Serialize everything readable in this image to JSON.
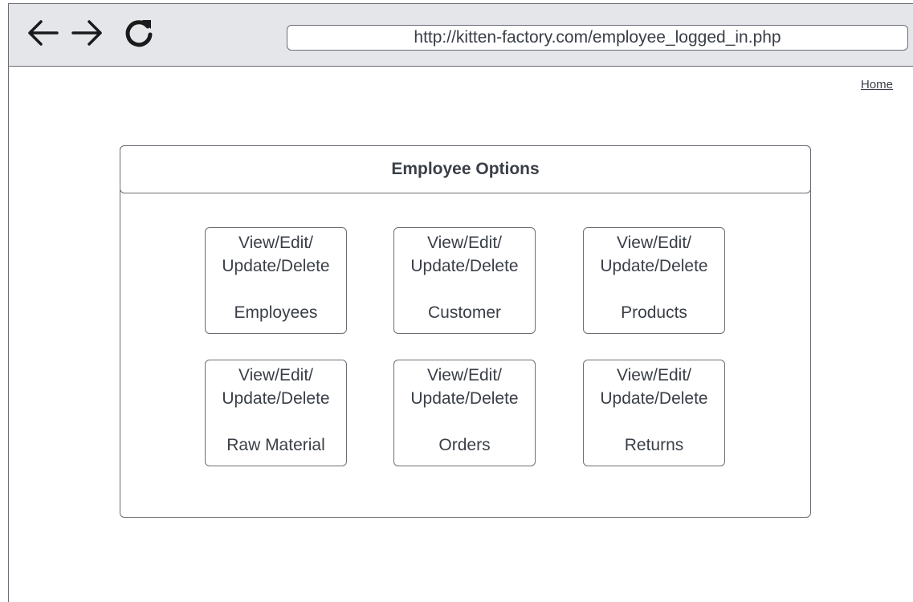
{
  "browser": {
    "url": "http://kitten-factory.com/employee_logged_in.php",
    "back_icon": "arrow-left-icon",
    "forward_icon": "arrow-right-icon",
    "reload_icon": "reload-icon"
  },
  "header": {
    "home_link": "Home"
  },
  "panel": {
    "title": "Employee Options",
    "options": [
      {
        "line1": "View/Edit/",
        "line2": "Update/Delete",
        "entity": "Employees"
      },
      {
        "line1": "View/Edit/",
        "line2": "Update/Delete",
        "entity": "Customer"
      },
      {
        "line1": "View/Edit/",
        "line2": "Update/Delete",
        "entity": "Products"
      },
      {
        "line1": "View/Edit/",
        "line2": "Update/Delete",
        "entity": "Raw Material"
      },
      {
        "line1": "View/Edit/",
        "line2": "Update/Delete",
        "entity": "Orders"
      },
      {
        "line1": "View/Edit/",
        "line2": "Update/Delete",
        "entity": "Returns"
      }
    ]
  }
}
